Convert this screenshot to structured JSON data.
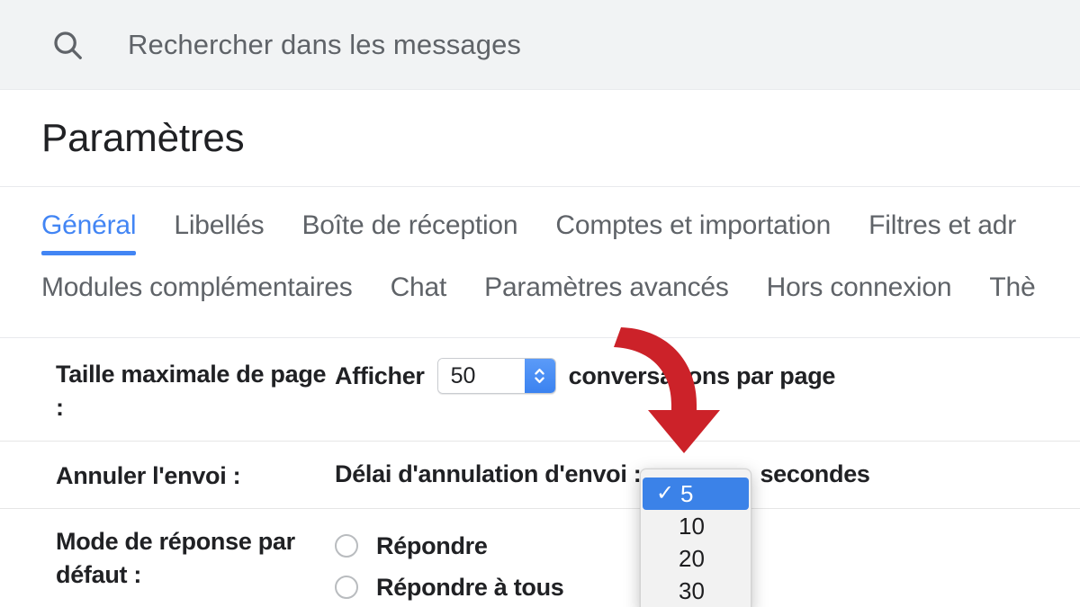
{
  "search": {
    "placeholder": "Rechercher dans les messages",
    "value": "",
    "icon": "search-icon"
  },
  "header": {
    "title": "Paramètres"
  },
  "tabs": {
    "active": "Général",
    "row1": [
      {
        "label": "Général",
        "active": true
      },
      {
        "label": "Libellés",
        "active": false
      },
      {
        "label": "Boîte de réception",
        "active": false
      },
      {
        "label": "Comptes et importation",
        "active": false
      },
      {
        "label": "Filtres et adr",
        "active": false
      }
    ],
    "row2": [
      {
        "label": "Modules complémentaires",
        "active": false
      },
      {
        "label": "Chat",
        "active": false
      },
      {
        "label": "Paramètres avancés",
        "active": false
      },
      {
        "label": "Hors connexion",
        "active": false
      },
      {
        "label": "Thè",
        "active": false
      }
    ]
  },
  "settings": {
    "page_size": {
      "label": "Taille maximale de page :",
      "prefix": "Afficher",
      "value": "50",
      "suffix": "conversations par page",
      "stepper_icon": "stepper-updown-icon"
    },
    "undo_send": {
      "label": "Annuler l'envoi :",
      "prefix": "Délai d'annulation d'envoi :",
      "value": "5",
      "suffix": "secondes"
    },
    "default_reply": {
      "label": "Mode de réponse par défaut :",
      "options": [
        {
          "label": "Répondre",
          "selected": false
        },
        {
          "label": "Répondre à tous",
          "selected": false
        }
      ]
    }
  },
  "dropdown": {
    "open": true,
    "selected": "5",
    "check_glyph": "✓",
    "options": [
      {
        "label": "5",
        "selected": true
      },
      {
        "label": "10",
        "selected": false
      },
      {
        "label": "20",
        "selected": false
      },
      {
        "label": "30",
        "selected": false
      }
    ]
  },
  "annotation": {
    "arrow": {
      "name": "red-down-arrow-icon",
      "color": "#CC2229",
      "points_to": "undo-send-dropdown"
    }
  },
  "colors": {
    "accent_blue": "#4285F4",
    "highlight_blue": "#3B82E8",
    "search_bg": "#F1F3F4",
    "text_primary": "#202124",
    "text_secondary": "#5F6368",
    "annotation_red": "#CC2229"
  }
}
